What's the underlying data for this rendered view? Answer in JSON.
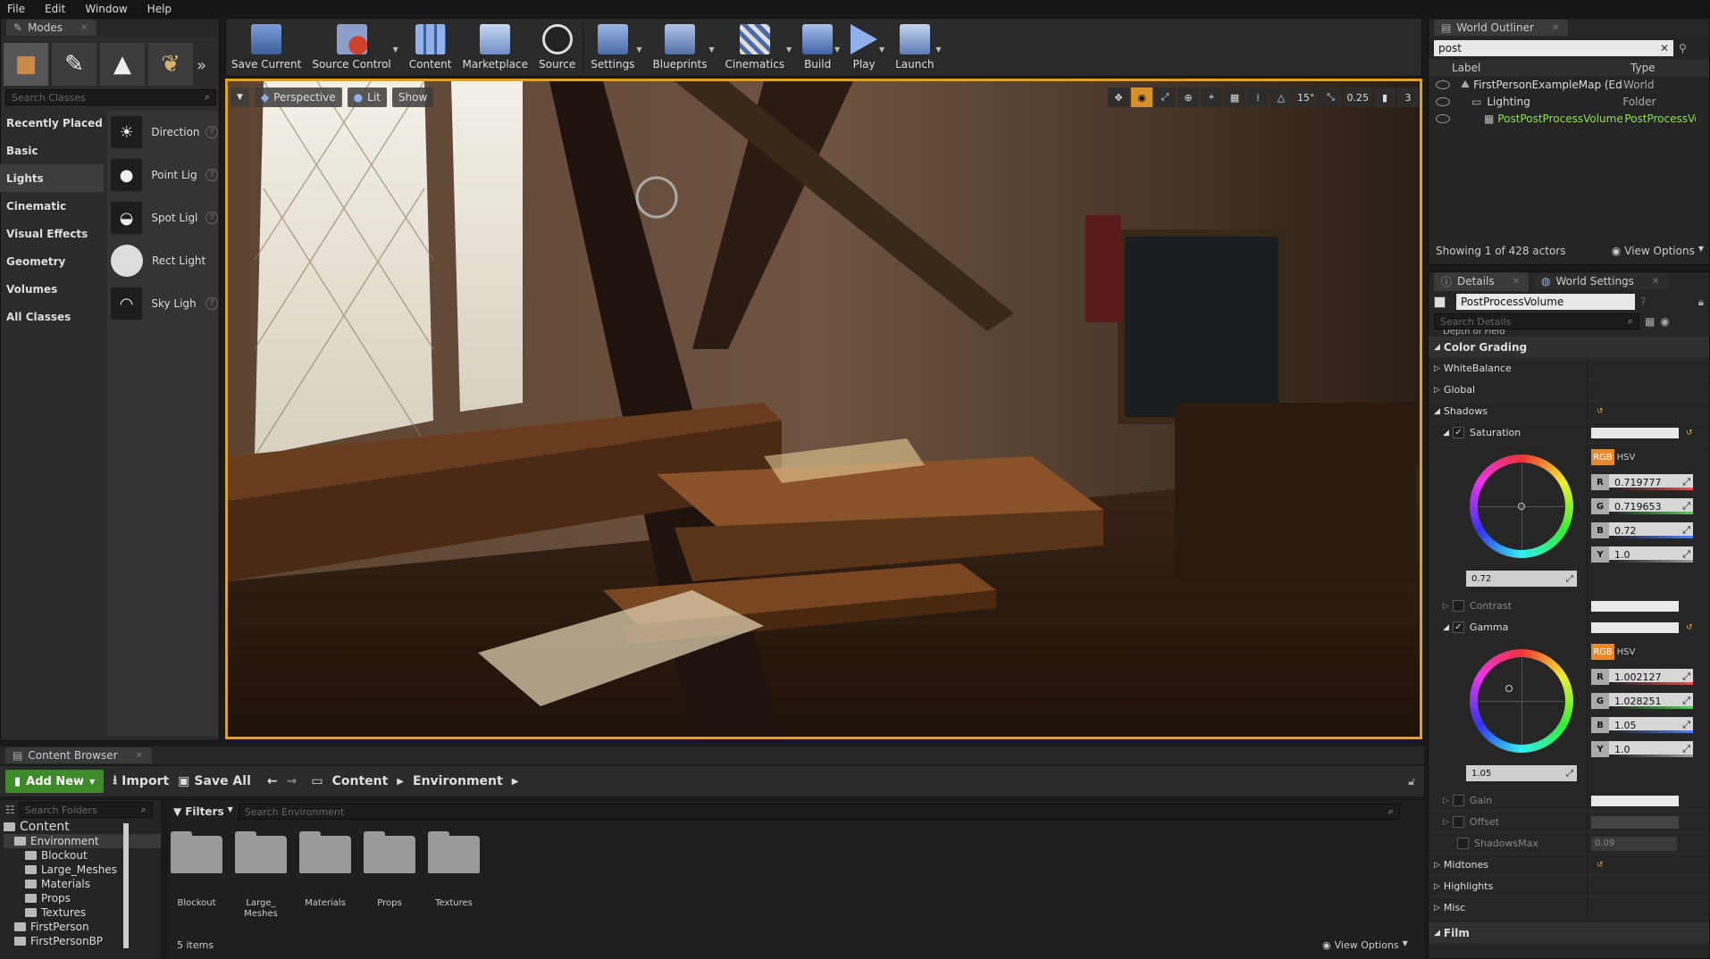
{
  "menu": [
    "File",
    "Edit",
    "Window",
    "Help"
  ],
  "modes": {
    "tab_label": "Modes",
    "search_placeholder": "Search Classes",
    "categories": [
      "Recently Placed",
      "Basic",
      "Lights",
      "Cinematic",
      "Visual Effects",
      "Geometry",
      "Volumes",
      "All Classes"
    ],
    "selected_category": "Lights",
    "lights": [
      "Direction",
      "Point Lig",
      "Spot Ligl",
      "Rect Light",
      "Sky Ligh"
    ]
  },
  "toolbar": {
    "buttons": [
      "Save Current",
      "Source Control",
      "Content",
      "Marketplace",
      "Source",
      "Settings",
      "Blueprints",
      "Cinematics",
      "Build",
      "Play",
      "Launch"
    ]
  },
  "viewport": {
    "perspective": "Perspective",
    "lit": "Lit",
    "show": "Show",
    "angle": "15°",
    "scale": "0.25",
    "cam": "3"
  },
  "content_browser": {
    "tab_label": "Content Browser",
    "add_new": "Add New",
    "import": "Import",
    "save_all": "Save All",
    "path": [
      "Content",
      "Environment"
    ],
    "search_folders_placeholder": "Search Folders",
    "filters": "Filters",
    "search_placeholder": "Search Environment",
    "tree": [
      {
        "label": "Content",
        "level": 0
      },
      {
        "label": "Environment",
        "level": 1
      },
      {
        "label": "Blockout",
        "level": 2
      },
      {
        "label": "Large_Meshes",
        "level": 2
      },
      {
        "label": "Materials",
        "level": 2
      },
      {
        "label": "Props",
        "level": 2
      },
      {
        "label": "Textures",
        "level": 2
      },
      {
        "label": "FirstPerson",
        "level": 1
      },
      {
        "label": "FirstPersonBP",
        "level": 1
      }
    ],
    "assets": [
      "Blockout",
      "Large_\nMeshes",
      "Materials",
      "Props",
      "Textures"
    ],
    "item_count": "5 items",
    "view_options": "View Options"
  },
  "outliner": {
    "tab_label": "World Outliner",
    "search_value": "post",
    "col_label": "Label",
    "col_type": "Type",
    "rows": [
      {
        "label": "FirstPersonExampleMap (Edito",
        "type": "World"
      },
      {
        "label": "Lighting",
        "type": "Folder"
      },
      {
        "label": "PostPostProcessVolume",
        "type": "PostProcessVo"
      }
    ],
    "status": "Showing 1 of 428 actors",
    "view_options": "View Options"
  },
  "details": {
    "tab_details": "Details",
    "tab_world": "World Settings",
    "object_name": "PostProcessVolume",
    "search_placeholder": "Search Details",
    "cut_row": "Depth of Field",
    "section": "Color Grading",
    "white_balance": "WhiteBalance",
    "global": "Global",
    "shadows": "Shadows",
    "saturation": "Saturation",
    "sat_values": {
      "R": "0.719777",
      "G": "0.719653",
      "B": "0.72",
      "Y": "1.0",
      "field": "0.72"
    },
    "contrast": "Contrast",
    "gamma": "Gamma",
    "gamma_values": {
      "R": "1.002127",
      "G": "1.028251",
      "B": "1.05",
      "Y": "1.0",
      "field": "1.05"
    },
    "gain": "Gain",
    "offset": "Offset",
    "shadows_max": "ShadowsMax",
    "shadows_max_val": "0.09",
    "midtones": "Midtones",
    "highlights": "Highlights",
    "misc": "Misc",
    "film": "Film",
    "rgb": "RGB",
    "hsv": "HSV"
  },
  "colors": {
    "accent": "#e0a020",
    "add_new": "#3c8a2a",
    "selected_green": "#8fe04a"
  }
}
